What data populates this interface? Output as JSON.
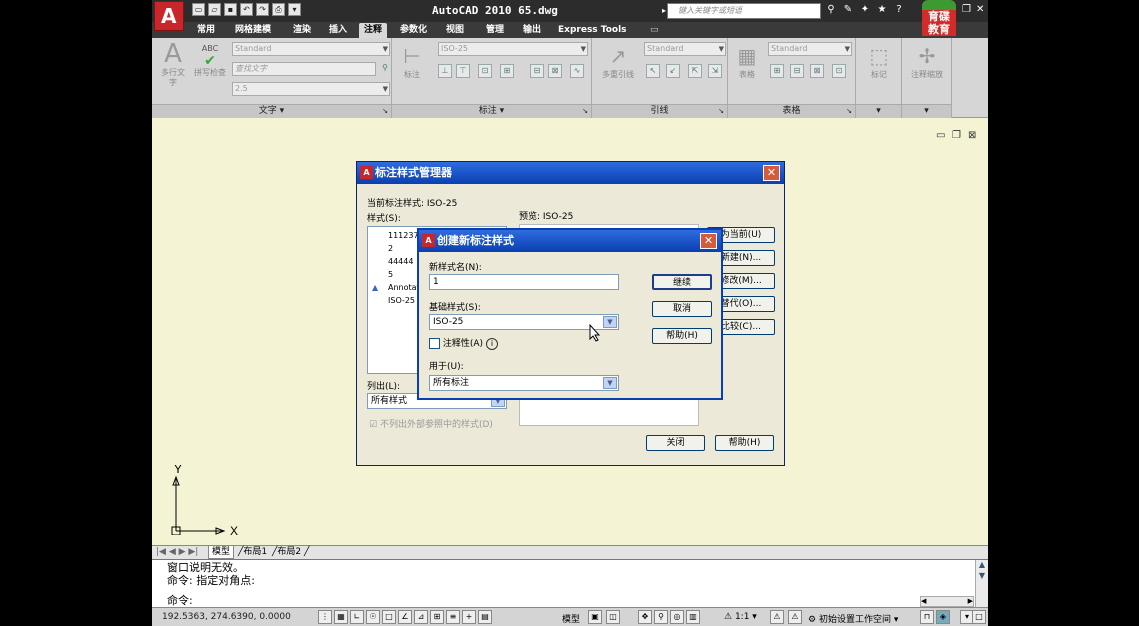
{
  "app": {
    "title": "AutoCAD 2010   65.dwg",
    "search_placeholder": "键入关键字或短语",
    "watermark": "育碟教育"
  },
  "tabs": [
    "常用",
    "网格建模",
    "渲染",
    "插入",
    "注释",
    "参数化",
    "视图",
    "管理",
    "输出",
    "Express Tools"
  ],
  "active_tab": "注释",
  "ribbon": {
    "text_panel": {
      "title": "文字",
      "multiline_text": "多行文字",
      "spell_check": "拼写检查",
      "abc": "ABC",
      "style_combo": "Standard",
      "find_combo": "查找文字",
      "height_combo": "2.5"
    },
    "dim_panel": {
      "title": "标注",
      "dim_label": "标注",
      "style_combo": "ISO-25"
    },
    "leader_panel": {
      "title": "引线",
      "multileader": "多重引线",
      "style_combo": "Standard"
    },
    "table_panel": {
      "title": "表格",
      "table_label": "表格",
      "style_combo": "Standard"
    },
    "markup_panel": {
      "label": "标记"
    },
    "anno_panel": {
      "label": "注释缩放"
    }
  },
  "layout_tabs": [
    "模型",
    "布局1",
    "布局2"
  ],
  "command": {
    "line1": "窗口说明无效。",
    "line2": "命令: 指定对角点:",
    "line3": "命令:"
  },
  "status": {
    "coords": "192.5363, 274.6390, 0.0000",
    "model": "模型",
    "scale": "1:1",
    "workspace": "初始设置工作空间"
  },
  "ucs": {
    "x": "X",
    "y": "Y"
  },
  "dim_manager": {
    "title": "标注样式管理器",
    "current_style": "当前标注样式: ISO-25",
    "styles_label": "样式(S):",
    "preview_label": "预览: ISO-25",
    "styles": [
      "111237",
      "2",
      "44444",
      "5",
      "Annotative",
      "ISO-25"
    ],
    "list_label": "列出(L):",
    "list_value": "所有样式",
    "no_xref": "不列出外部参照中的样式(D)",
    "buttons": {
      "set_current": "为当前(U)",
      "new": "新建(N)...",
      "modify": "修改(M)...",
      "override": "替代(O)...",
      "compare": "比较(C)...",
      "close": "关闭",
      "help": "帮助(H)"
    }
  },
  "new_style": {
    "title": "创建新标注样式",
    "name_label": "新样式名(N):",
    "name_value": "1",
    "base_label": "基础样式(S):",
    "base_value": "ISO-25",
    "annotative_label": "注释性(A)",
    "use_for_label": "用于(U):",
    "use_for_value": "所有标注",
    "continue": "继续",
    "cancel": "取消",
    "help": "帮助(H)"
  }
}
